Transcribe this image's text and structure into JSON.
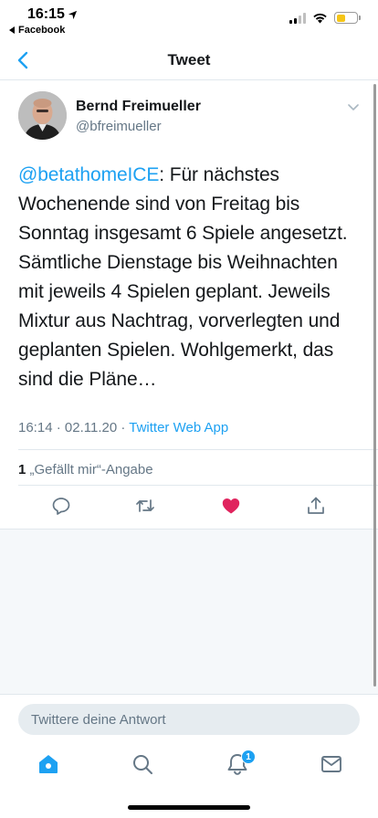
{
  "status": {
    "time": "16:15",
    "back_app": "Facebook"
  },
  "nav": {
    "title": "Tweet"
  },
  "tweet": {
    "author_name": "Bernd Freimueller",
    "author_handle": "@bfreimueller",
    "mention": "@betathomeICE",
    "text": ": Für nächstes Wochenende sind von Freitag bis Sonntag insgesamt 6 Spiele angesetzt. Sämtliche Dienstage bis Weihnachten mit jeweils 4 Spielen geplant. Jeweils Mixtur aus Nachtrag, vorverlegten und geplanten Spielen. Wohlgemerkt, das sind die Pläne…",
    "time": "16:14",
    "date": "02.11.20",
    "separator": "·",
    "source": "Twitter Web App",
    "like_count": "1",
    "like_label": "„Gefällt mir“-Angabe",
    "liked": true
  },
  "reply": {
    "placeholder": "Twittere deine Antwort"
  },
  "tabbar": {
    "notification_count": "1"
  },
  "colors": {
    "accent": "#1da1f2",
    "like": "#e0245e",
    "secondary_text": "#657786"
  },
  "icons": {
    "nav_back": "chevron-left-icon",
    "caret": "chevron-down-icon",
    "reply": "reply-icon",
    "retweet": "retweet-icon",
    "like": "heart-icon",
    "share": "share-icon",
    "home": "home-icon",
    "search": "search-icon",
    "notifications": "bell-icon",
    "messages": "mail-icon"
  }
}
